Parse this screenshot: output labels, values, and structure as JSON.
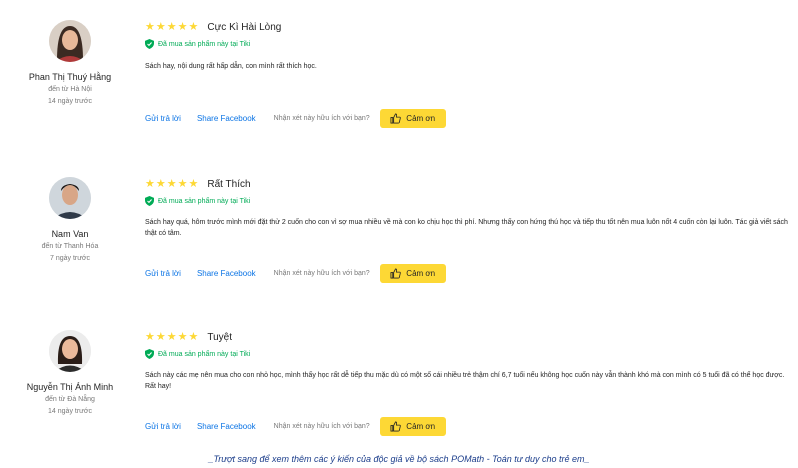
{
  "reviews": [
    {
      "name": "Phan Thị Thuý Hằng",
      "location": "đến từ Hà Nội",
      "time_ago": "14 ngày trước",
      "rating": 5,
      "title": "Cực Kì Hài Lòng",
      "verified": "Đã mua sản phẩm này tại Tiki",
      "body": "Sách hay, nội dung rất hấp dẫn, con mình rất thích học."
    },
    {
      "name": "Nam Van",
      "location": "đến từ Thanh Hóa",
      "time_ago": "7 ngày trước",
      "rating": 5,
      "title": "Rất Thích",
      "verified": "Đã mua sản phẩm này tại Tiki",
      "body": "Sách hay quá, hôm trước mình mới đặt thử 2 cuốn cho con vì sợ mua nhiều về mà con ko chịu học thì phí. Nhưng thấy con hứng thú học và tiếp thu tốt nên mua luôn nốt 4 cuốn còn lại luôn. Tác giả viết sách thật có tâm."
    },
    {
      "name": "Nguyễn Thị Ánh Minh",
      "location": "đến từ Đà Nẵng",
      "time_ago": "14 ngày trước",
      "rating": 5,
      "title": "Tuyệt",
      "verified": "Đã mua sản phẩm này tại Tiki",
      "body": "Sách này các mẹ nên mua cho con nhỏ học, mình thấy học rất dễ tiếp thu mặc dù có một số cái nhiều trẻ thậm chí 6,7 tuổi nếu không học cuốn này vẫn thành khó mà con mình có 5 tuổi đã có thể học được.\nRất hay!"
    }
  ],
  "actions": {
    "reply": "Gửi trả lời",
    "share": "Share Facebook",
    "helpful_question": "Nhận xét này hữu ích với bạn?",
    "thanks": "Cảm ơn"
  },
  "footer": "_Trượt sang để xem thêm các ý kiến của  độc giả về bộ sách POMath - Toán tư duy cho trẻ em_",
  "colors": {
    "star": "#fdd835",
    "verified": "#00ab56",
    "link": "#0b74e5",
    "thanks_bg": "#fdd835",
    "footer": "#1a3c8a"
  },
  "icons": [
    "star-icon",
    "verified-shield-icon",
    "thumbs-up-icon"
  ]
}
